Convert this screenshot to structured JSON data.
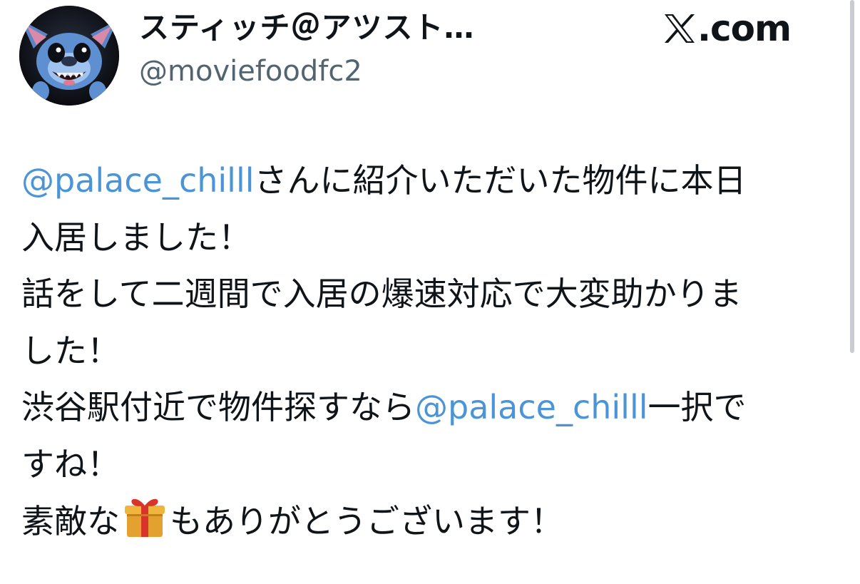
{
  "header": {
    "display_name": "スティッチ＠アツスト…",
    "handle": "@moviefoodfc2",
    "avatar_icon": "stitch-avatar-icon"
  },
  "brand": {
    "icon": "x-logo-icon",
    "text": ".com"
  },
  "post": {
    "line1": {
      "mention": "@palace_chilll",
      "text": "さんに紹介いただいた物件に本日"
    },
    "line2": "入居しました！",
    "line3": "話をして二週間で入居の爆速対応で大変助かりま",
    "line4": "した！",
    "line5": {
      "pre": "渋谷駅付近で物件探すなら",
      "mention": "@palace_chilll",
      "post": "一択で"
    },
    "line6": "すね！",
    "line7": {
      "pre": "素敵な",
      "emoji_icon": "gift-icon",
      "post": "もありがとうございます！"
    }
  },
  "colors": {
    "mention": "#4b94d6",
    "handle": "#536471",
    "text": "#0f1419",
    "background": "#ffffff"
  }
}
